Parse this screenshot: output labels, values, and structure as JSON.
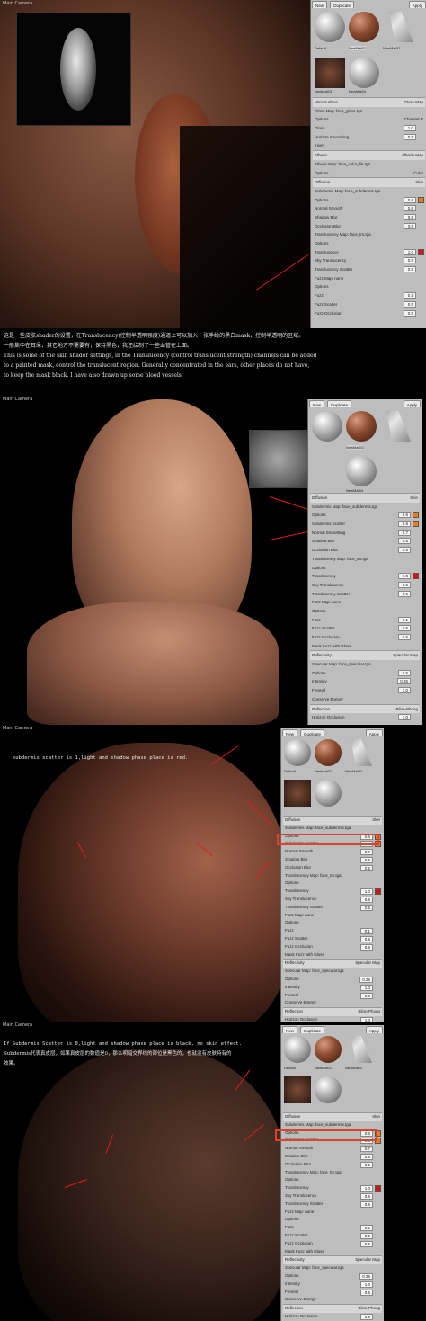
{
  "panels": [
    {
      "viewport_title": "Main Camera",
      "sidebar": {
        "buttons": [
          "New",
          "Duplicate",
          "Apply"
        ],
        "materials": [
          "Default",
          "NewMat01",
          "NewMat02",
          "NewMat03",
          "NewMat04"
        ],
        "rows": [
          {
            "label": "Microsurface",
            "right": "Gloss Map"
          },
          {
            "label": "Gloss Map: face_gloss.tga"
          },
          {
            "label": "Options",
            "right": "Channel R"
          },
          {
            "label": "Gloss",
            "value": "1.0"
          },
          {
            "label": "Horizon Smoothing",
            "value": "0.5"
          },
          {
            "label": "Invert"
          },
          {
            "label": "Albedo",
            "right": "Albedo Map"
          },
          {
            "label": "Albedo Map: face_color_bk.tga"
          },
          {
            "label": "Options",
            "right": "Color"
          },
          {
            "label": "Diffusion",
            "right": "Skin"
          },
          {
            "label": "Subdermis Map: face_subdermis.tga"
          },
          {
            "label": "Options",
            "value": "0.6"
          },
          {
            "label": "Normal Smooth",
            "value": "0.6"
          },
          {
            "label": "Shadow Blur",
            "value": "0.6"
          },
          {
            "label": "Occlusion Blur",
            "value": "0.6"
          },
          {
            "label": "Translucency Map: face_trs.tga"
          },
          {
            "label": "Options"
          },
          {
            "label": "Translucency",
            "value": "1.0"
          },
          {
            "label": "Sky Translucency",
            "value": "0.5"
          },
          {
            "label": "Translucency Scatter",
            "value": "0.5"
          },
          {
            "label": "Fuzz Map: none"
          },
          {
            "label": "Options"
          },
          {
            "label": "Fuzz",
            "value": "0.1"
          },
          {
            "label": "Fuzz Scatter",
            "value": "0.5"
          },
          {
            "label": "Fuzz Occlusion",
            "value": "0.5"
          }
        ]
      }
    },
    {
      "viewport_title": "Main Camera",
      "sidebar": {
        "buttons": [
          "New",
          "Duplicate",
          "Apply"
        ],
        "materials": [
          "NewMat03",
          "NewMat04",
          "NewMat05"
        ],
        "rows": [
          {
            "label": "Diffusion",
            "right": "Skin"
          },
          {
            "label": "Subdermis Map: face_subdermis.tga"
          },
          {
            "label": "Options",
            "value": "0.6"
          },
          {
            "label": "Subdermis Scatter",
            "value": "0.6"
          },
          {
            "label": "Normal Smoothing",
            "value": "0.7"
          },
          {
            "label": "Shadow Blur",
            "value": "0.5"
          },
          {
            "label": "Occlusion Blur",
            "value": "0.5"
          },
          {
            "label": "Translucency Map: face_trs.tga"
          },
          {
            "label": "Options"
          },
          {
            "label": "Translucency",
            "value": "1.0"
          },
          {
            "label": "Sky Translucency",
            "value": "0.5"
          },
          {
            "label": "Translucency Scatter",
            "value": "0.5"
          },
          {
            "label": "Fuzz Map: none"
          },
          {
            "label": "Options"
          },
          {
            "label": "Fuzz",
            "value": "0.1"
          },
          {
            "label": "Fuzz Scatter",
            "value": "0.5"
          },
          {
            "label": "Fuzz Occlusion",
            "value": "0.5"
          },
          {
            "label": "Mask Fuzz with Gloss"
          },
          {
            "label": "Reflectivity",
            "right": "Specular Map"
          },
          {
            "label": "Specular Map: face_specular.tga"
          },
          {
            "label": "Options",
            "value": "0.5"
          },
          {
            "label": "Intensity",
            "value": "0.35"
          },
          {
            "label": "Fresnel",
            "value": "1.0"
          },
          {
            "label": "Conserve Energy"
          },
          {
            "label": "Reflection",
            "right": "Blinn-Phong"
          },
          {
            "label": "Horizon Occlusion",
            "value": "1.0"
          }
        ]
      }
    },
    {
      "viewport_title": "Main Camera",
      "sidebar": {
        "buttons": [
          "New",
          "Duplicate",
          "Apply"
        ],
        "materials": [
          "Default",
          "NewMat01",
          "NewMat02"
        ],
        "rows": [
          {
            "label": "Diffusion",
            "right": "Skin"
          },
          {
            "label": "Subdermis Map: face_subdermis.tga"
          },
          {
            "label": "Options",
            "value": "0.6"
          },
          {
            "label": "Subdermis Scatter",
            "value": "1.0"
          },
          {
            "label": "Normal Smooth",
            "value": "0.7"
          },
          {
            "label": "Shadow Blur",
            "value": "0.5"
          },
          {
            "label": "Occlusion Blur",
            "value": "0.5"
          },
          {
            "label": "Translucency Map: face_trs.tga"
          },
          {
            "label": "Options"
          },
          {
            "label": "Translucency",
            "value": "1.0"
          },
          {
            "label": "Sky Translucency",
            "value": "0.5"
          },
          {
            "label": "Translucency Scatter",
            "value": "0.5"
          },
          {
            "label": "Fuzz Map: none"
          },
          {
            "label": "Options"
          },
          {
            "label": "Fuzz",
            "value": "0.1"
          },
          {
            "label": "Fuzz Scatter",
            "value": "0.5"
          },
          {
            "label": "Fuzz Occlusion",
            "value": "0.5"
          },
          {
            "label": "Mask Fuzz with Gloss"
          },
          {
            "label": "Reflectivity",
            "right": "Specular Map"
          },
          {
            "label": "Specular Map: face_specular.tga"
          },
          {
            "label": "Options",
            "value": "0.35"
          },
          {
            "label": "Intensity",
            "value": "1.0"
          },
          {
            "label": "Fresnel",
            "value": "0.5"
          },
          {
            "label": "Conserve Energy"
          },
          {
            "label": "Reflection",
            "right": "Blinn-Phong"
          },
          {
            "label": "Horizon Occlusion",
            "value": "1.0"
          }
        ]
      },
      "overlay_lines": [
        "subdermis scatter is 1,light and shadow phase place is red."
      ]
    },
    {
      "viewport_title": "Main Camera",
      "sidebar": {
        "buttons": [
          "New",
          "Duplicate",
          "Apply"
        ],
        "materials": [
          "Default",
          "NewMat01",
          "NewMat02"
        ],
        "rows": [
          {
            "label": "Diffusion",
            "right": "Skin"
          },
          {
            "label": "Subdermis Map: face_subdermis.tga"
          },
          {
            "label": "Options",
            "value": "0.6"
          },
          {
            "label": "Subdermis Scatter",
            "value": "0.0"
          },
          {
            "label": "Normal Smooth",
            "value": "0.7"
          },
          {
            "label": "Shadow Blur",
            "value": "0.5"
          },
          {
            "label": "Occlusion Blur",
            "value": "0.5"
          },
          {
            "label": "Translucency Map: face_trs.tga"
          },
          {
            "label": "Options"
          },
          {
            "label": "Translucency",
            "value": "1.0"
          },
          {
            "label": "Sky Translucency",
            "value": "0.5"
          },
          {
            "label": "Translucency Scatter",
            "value": "0.5"
          },
          {
            "label": "Fuzz Map: none"
          },
          {
            "label": "Options"
          },
          {
            "label": "Fuzz",
            "value": "0.1"
          },
          {
            "label": "Fuzz Scatter",
            "value": "0.5"
          },
          {
            "label": "Fuzz Occlusion",
            "value": "0.5"
          },
          {
            "label": "Mask Fuzz with Gloss"
          },
          {
            "label": "Reflectivity",
            "right": "Specular Map"
          },
          {
            "label": "Specular Map: face_specular.tga"
          },
          {
            "label": "Options",
            "value": "0.35"
          },
          {
            "label": "Intensity",
            "value": "1.0"
          },
          {
            "label": "Fresnel",
            "value": "0.5"
          },
          {
            "label": "Conserve Energy"
          },
          {
            "label": "Reflection",
            "right": "Blinn-Phong"
          },
          {
            "label": "Horizon Occlusion",
            "value": "1.0"
          }
        ]
      },
      "overlay_lines": [
        "If Subdermis Scatter is 0,light and shadow phase place is black, no skin effect.",
        "Subdermis代表真皮层，如果真皮层的数值是0，那么明暗交界线的部位是黑色的，也就没有皮肤特有的",
        "效果。"
      ]
    }
  ],
  "caption": [
    "这是一些皮肤shader的设置，在Translucency(控制半透明强度)通道上可以加入一张手绘的黑白mask，控制半透明的区域。",
    "一般集中在耳朵，其它地方不需要有，保持黑色，我还绘制了一些血管在上面。",
    "This is some of the skin shader settings, in the Translucency (control translucent strength) channels can be added",
    "to a painted mask, control the translucent region. Generally concentrated in the ears, other places do not have,",
    "to keep the mask black. I have also drawn up some blood vessels."
  ],
  "colors": {
    "accent_red": "#e31d1d",
    "swatch_orange": "#f07a10",
    "swatch_red": "#e01010",
    "sidebar_bg": "#bdbdbd"
  }
}
